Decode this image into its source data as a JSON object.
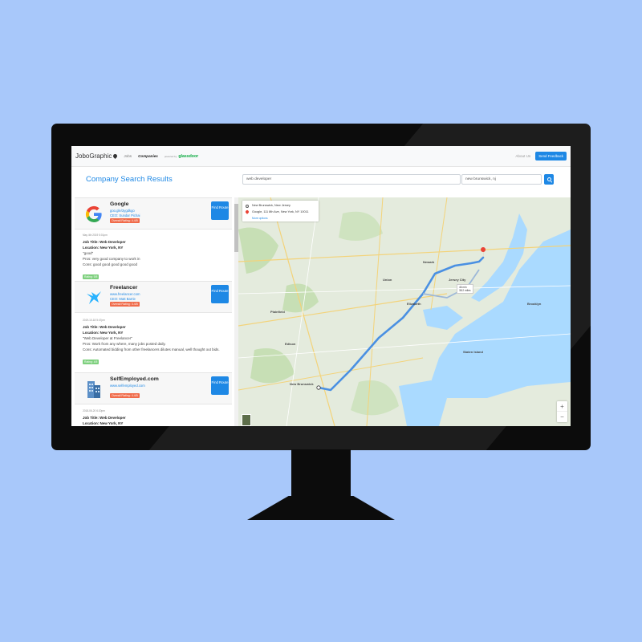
{
  "nav": {
    "brand": "JoboGraphic",
    "links": [
      "Jobs",
      "Companies"
    ],
    "powered_by": "powered by",
    "powered_brand": "glassdoor",
    "about": "About Us",
    "feedback": "Send Feedback"
  },
  "search": {
    "title": "Company Search Results",
    "job_query": "web developer",
    "location_query": "new brunswick, nj"
  },
  "companies": [
    {
      "name": "Google",
      "url": "goo.gle/3ygdkgo",
      "ceo": "CEO: Sundar Pichai",
      "rating": "Overall Rating: 4.4/5",
      "button": "Find Route",
      "review": {
        "meta": "May 4th 2019 5:01pm",
        "title": "Job Title: Web Developer",
        "location": "Location: New York, NY",
        "headline": "\"good\"",
        "pros": "Pros: very good company to work in",
        "cons": "Cons: good good good good good",
        "rating": "Rating: 5/5"
      }
    },
    {
      "name": "Freelancer",
      "url": "www.freelancer.com",
      "ceo": "CEO: Matt Barrie",
      "rating": "Overall Rating: 3.4/5",
      "button": "Find Route",
      "review": {
        "meta": "2019-10-18 5:47pm",
        "title": "Job Title: Web Developer",
        "location": "Location: New York, NY",
        "headline": "\"Web Developer at Freelancer\"",
        "pros": "Pros: Work from any where, many jobs posted daily.",
        "cons": "Cons: Automated bidding from other freelancers dilutes manual, well thought out bids.",
        "rating": "Rating: 4/5"
      }
    },
    {
      "name": "SelfEmployed.com",
      "url": "www.selfemployed.com",
      "ceo": "",
      "rating": "Overall Rating: 4.4/5",
      "button": "Find Route",
      "review": {
        "meta": "2018-06-20 6:20pm",
        "title": "Job Title: Web Developer",
        "location": "Location: New York, NY"
      }
    }
  ],
  "map": {
    "origin": "New Brunswick, New Jersey",
    "destination": "Google, 111 8th Ave, New York, NY 10011",
    "more_options": "More options",
    "zoom_in": "+",
    "zoom_out": "−",
    "route_time": "46 min",
    "route_dist": "38.2 miles",
    "places": [
      "Newark",
      "New Brunswick",
      "Staten Island",
      "Jersey City",
      "Elizabeth",
      "Edison",
      "Plainfield",
      "Union",
      "Brooklyn"
    ]
  },
  "colors": {
    "accent": "#1e88e5",
    "rating_badge": "#f06b4a",
    "review_badge": "#7ed07e",
    "route": "#4a90e2"
  }
}
